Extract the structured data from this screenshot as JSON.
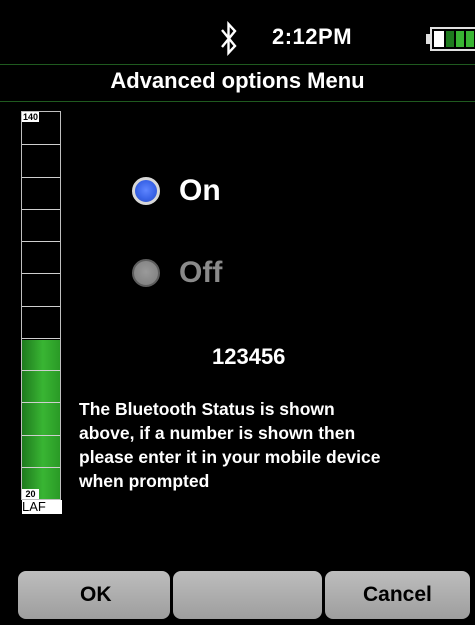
{
  "status_bar": {
    "time": "2:12PM",
    "bluetooth_icon": "bluetooth-icon",
    "battery_icon": "battery-icon",
    "battery_level": 0.75
  },
  "title": "Advanced options Menu",
  "level_meter": {
    "max_label": "140",
    "min_label": "20",
    "unit": "LAF",
    "fill_fraction": 0.41,
    "fill_color": "#39b533"
  },
  "bluetooth_options": {
    "on_label": "On",
    "off_label": "Off",
    "selected": "On",
    "selected_color": "#3a64e8",
    "unselected_color": "#7b7b7b"
  },
  "passkey": "123456",
  "message": "The Bluetooth Status is shown\nabove, if a number is shown then\nplease enter it in your mobile device\nwhen prompted",
  "softkeys": {
    "left": "OK",
    "middle": "",
    "right": "Cancel"
  }
}
